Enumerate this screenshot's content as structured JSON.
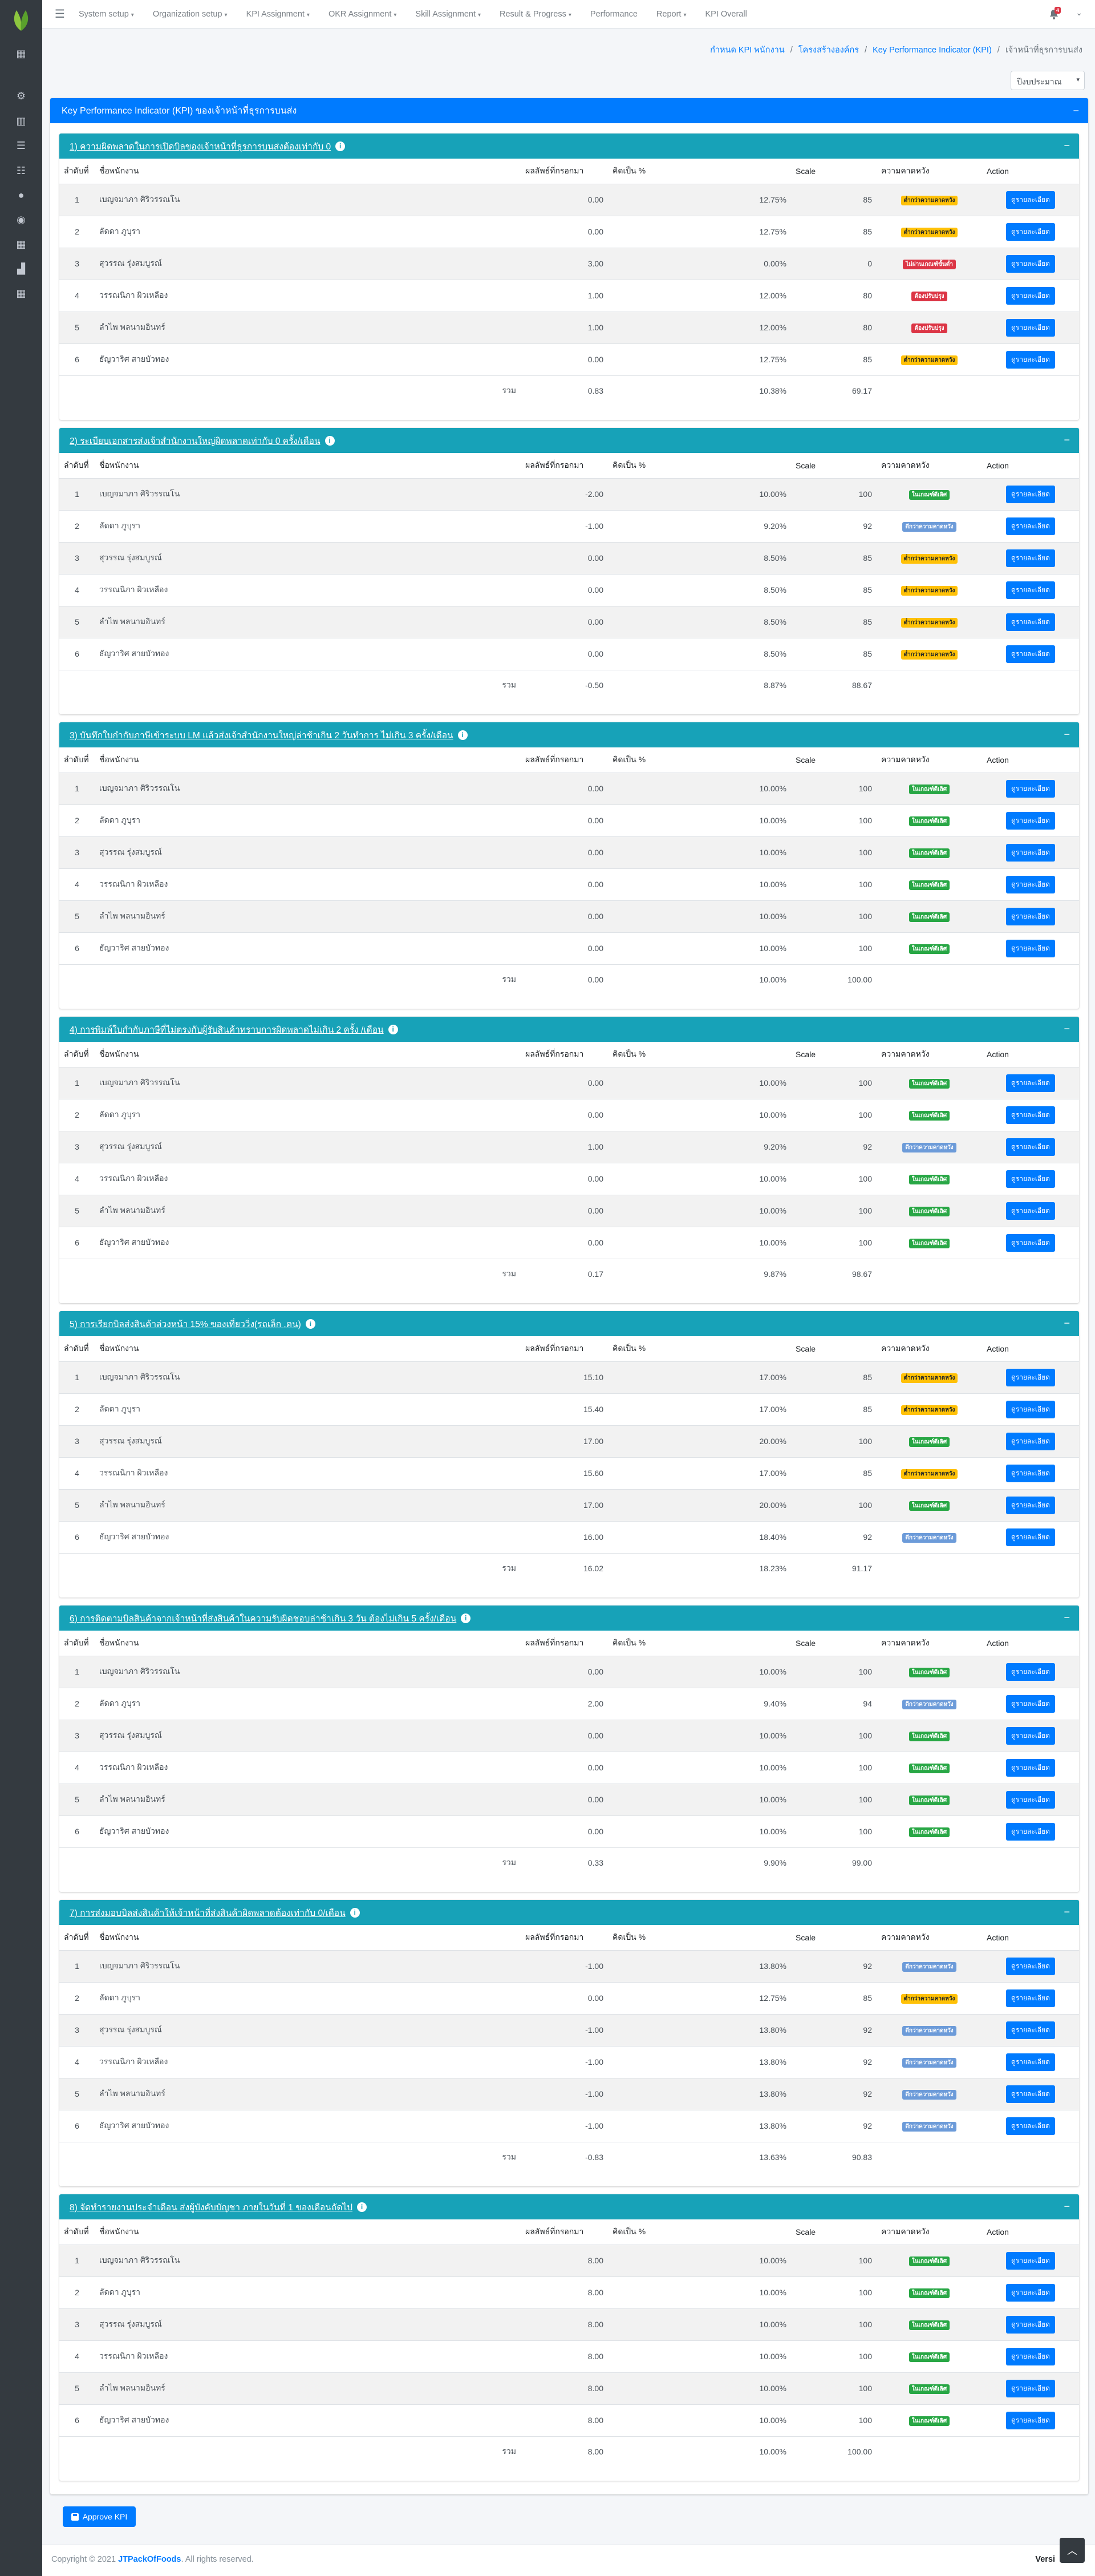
{
  "topbar": {
    "menus": [
      "System setup",
      "Organization setup",
      "KPI Assignment",
      "OKR Assignment",
      "Skill Assignment",
      "Result & Progress",
      "Performance",
      "Report",
      "KPI Overall"
    ],
    "menu_has_caret": [
      true,
      true,
      true,
      true,
      true,
      true,
      false,
      true,
      false
    ],
    "notif_count": "4"
  },
  "breadcrumb": [
    "กำหนด KPI พนักงาน",
    "โครงสร้างองค์กร",
    "Key Performance Indicator (KPI)",
    "เจ้าหน้าที่ธุรการบนส่ง"
  ],
  "year_select": "ปีงบประมาณ",
  "main_title": "Key Performance Indicator (KPI) ของเจ้าหน้าที่ธุรการบนส่ง",
  "columns": [
    "ลำดับที่",
    "ชื่อพนักงาน",
    "ผลลัพธ์ที่กรอกมา",
    "คิดเป็น %",
    "Scale",
    "ความคาดหวัง",
    "Action"
  ],
  "total_label": "รวม",
  "view_label": "ดูรายละเอียด",
  "employees": [
    "เบญจมาภา ศิริวรรณโน",
    "ลัดดา ภูบุรา",
    "สุวรรณ รุ่งสมบูรณ์",
    "วรรณนิภา ผิวเหลือง",
    "ลำไพ พลนามอินทร์",
    "ธัญวาริศ สายบัวทอง"
  ],
  "badge_labels": {
    "warn": "ต่ำกว่าความคาดหวัง",
    "succ": "ในเกณฑ์ดีเลิศ",
    "info": "ดีกว่าความคาดหวัง",
    "dang": "ไม่ผ่านเกณฑ์ขั้นต่ำ",
    "dang2": "ต้องปรับปรุง"
  },
  "sections": [
    {
      "title": "1) ความผิดพลาดในการเปิดบิลของเจ้าหน้าที่ธุรการบนส่งต้องเท่ากับ 0",
      "rows": [
        {
          "no": "1",
          "result": "0.00",
          "pct": "12.75%",
          "scale": "85",
          "badge": "warn"
        },
        {
          "no": "2",
          "result": "0.00",
          "pct": "12.75%",
          "scale": "85",
          "badge": "warn"
        },
        {
          "no": "3",
          "result": "3.00",
          "pct": "0.00%",
          "scale": "0",
          "badge": "dang"
        },
        {
          "no": "4",
          "result": "1.00",
          "pct": "12.00%",
          "scale": "80",
          "badge": "dang2"
        },
        {
          "no": "5",
          "result": "1.00",
          "pct": "12.00%",
          "scale": "80",
          "badge": "dang2"
        },
        {
          "no": "6",
          "result": "0.00",
          "pct": "12.75%",
          "scale": "85",
          "badge": "warn"
        }
      ],
      "total": {
        "result": "0.83",
        "pct": "10.38%",
        "scale": "69.17"
      }
    },
    {
      "title": "2) ระเบียบเอกสารส่งเจ้าสำนักงานใหญ่ผิดพลาดเท่ากับ 0 ครั้ง/เดือน",
      "rows": [
        {
          "no": "1",
          "result": "-2.00",
          "pct": "10.00%",
          "scale": "100",
          "badge": "succ"
        },
        {
          "no": "2",
          "result": "-1.00",
          "pct": "9.20%",
          "scale": "92",
          "badge": "info"
        },
        {
          "no": "3",
          "result": "0.00",
          "pct": "8.50%",
          "scale": "85",
          "badge": "warn"
        },
        {
          "no": "4",
          "result": "0.00",
          "pct": "8.50%",
          "scale": "85",
          "badge": "warn"
        },
        {
          "no": "5",
          "result": "0.00",
          "pct": "8.50%",
          "scale": "85",
          "badge": "warn"
        },
        {
          "no": "6",
          "result": "0.00",
          "pct": "8.50%",
          "scale": "85",
          "badge": "warn"
        }
      ],
      "total": {
        "result": "-0.50",
        "pct": "8.87%",
        "scale": "88.67"
      }
    },
    {
      "title": "3) บันทึกใบกำกับภาษีเข้าระบบ LM แล้วส่งเจ้าสำนักงานใหญ่ล่าช้าเกิน 2 วันทำการ ไม่เกิน 3 ครั้ง/เดือน",
      "rows": [
        {
          "no": "1",
          "result": "0.00",
          "pct": "10.00%",
          "scale": "100",
          "badge": "succ"
        },
        {
          "no": "2",
          "result": "0.00",
          "pct": "10.00%",
          "scale": "100",
          "badge": "succ"
        },
        {
          "no": "3",
          "result": "0.00",
          "pct": "10.00%",
          "scale": "100",
          "badge": "succ"
        },
        {
          "no": "4",
          "result": "0.00",
          "pct": "10.00%",
          "scale": "100",
          "badge": "succ"
        },
        {
          "no": "5",
          "result": "0.00",
          "pct": "10.00%",
          "scale": "100",
          "badge": "succ"
        },
        {
          "no": "6",
          "result": "0.00",
          "pct": "10.00%",
          "scale": "100",
          "badge": "succ"
        }
      ],
      "total": {
        "result": "0.00",
        "pct": "10.00%",
        "scale": "100.00"
      }
    },
    {
      "title": "4) การพิมพ์ใบกำกับภาษีที่ไม่ตรงกับผู้รับสินค้าทราบการผิดพลาดไม่เกิน 2 ครั้ง /เดือน",
      "rows": [
        {
          "no": "1",
          "result": "0.00",
          "pct": "10.00%",
          "scale": "100",
          "badge": "succ"
        },
        {
          "no": "2",
          "result": "0.00",
          "pct": "10.00%",
          "scale": "100",
          "badge": "succ"
        },
        {
          "no": "3",
          "result": "1.00",
          "pct": "9.20%",
          "scale": "92",
          "badge": "info"
        },
        {
          "no": "4",
          "result": "0.00",
          "pct": "10.00%",
          "scale": "100",
          "badge": "succ"
        },
        {
          "no": "5",
          "result": "0.00",
          "pct": "10.00%",
          "scale": "100",
          "badge": "succ"
        },
        {
          "no": "6",
          "result": "0.00",
          "pct": "10.00%",
          "scale": "100",
          "badge": "succ"
        }
      ],
      "total": {
        "result": "0.17",
        "pct": "9.87%",
        "scale": "98.67"
      }
    },
    {
      "title": "5) การเรียกบิลส่งสินค้าล่วงหน้า 15% ของเที่ยววิ่ง(รถเล็ก ,คน)",
      "rows": [
        {
          "no": "1",
          "result": "15.10",
          "pct": "17.00%",
          "scale": "85",
          "badge": "warn"
        },
        {
          "no": "2",
          "result": "15.40",
          "pct": "17.00%",
          "scale": "85",
          "badge": "warn"
        },
        {
          "no": "3",
          "result": "17.00",
          "pct": "20.00%",
          "scale": "100",
          "badge": "succ"
        },
        {
          "no": "4",
          "result": "15.60",
          "pct": "17.00%",
          "scale": "85",
          "badge": "warn"
        },
        {
          "no": "5",
          "result": "17.00",
          "pct": "20.00%",
          "scale": "100",
          "badge": "succ"
        },
        {
          "no": "6",
          "result": "16.00",
          "pct": "18.40%",
          "scale": "92",
          "badge": "info"
        }
      ],
      "total": {
        "result": "16.02",
        "pct": "18.23%",
        "scale": "91.17"
      }
    },
    {
      "title": "6) การติดตามบิลสินค้าจากเจ้าหน้าที่ส่งสินค้าในความรับผิดชอบล่าช้าเกิน 3 วัน ต้องไม่เกิน 5 ครั้ง/เดือน",
      "rows": [
        {
          "no": "1",
          "result": "0.00",
          "pct": "10.00%",
          "scale": "100",
          "badge": "succ"
        },
        {
          "no": "2",
          "result": "2.00",
          "pct": "9.40%",
          "scale": "94",
          "badge": "info"
        },
        {
          "no": "3",
          "result": "0.00",
          "pct": "10.00%",
          "scale": "100",
          "badge": "succ"
        },
        {
          "no": "4",
          "result": "0.00",
          "pct": "10.00%",
          "scale": "100",
          "badge": "succ"
        },
        {
          "no": "5",
          "result": "0.00",
          "pct": "10.00%",
          "scale": "100",
          "badge": "succ"
        },
        {
          "no": "6",
          "result": "0.00",
          "pct": "10.00%",
          "scale": "100",
          "badge": "succ"
        }
      ],
      "total": {
        "result": "0.33",
        "pct": "9.90%",
        "scale": "99.00"
      }
    },
    {
      "title": "7) การส่งมอบบิลส่งสินค้าให้เจ้าหน้าที่ส่งสินค้าผิดพลาดต้องเท่ากับ 0/เดือน",
      "rows": [
        {
          "no": "1",
          "result": "-1.00",
          "pct": "13.80%",
          "scale": "92",
          "badge": "info"
        },
        {
          "no": "2",
          "result": "0.00",
          "pct": "12.75%",
          "scale": "85",
          "badge": "warn"
        },
        {
          "no": "3",
          "result": "-1.00",
          "pct": "13.80%",
          "scale": "92",
          "badge": "info"
        },
        {
          "no": "4",
          "result": "-1.00",
          "pct": "13.80%",
          "scale": "92",
          "badge": "info"
        },
        {
          "no": "5",
          "result": "-1.00",
          "pct": "13.80%",
          "scale": "92",
          "badge": "info"
        },
        {
          "no": "6",
          "result": "-1.00",
          "pct": "13.80%",
          "scale": "92",
          "badge": "info"
        }
      ],
      "total": {
        "result": "-0.83",
        "pct": "13.63%",
        "scale": "90.83"
      }
    },
    {
      "title": "8) จัดทำรายงานประจำเดือน ส่งผู้บังคับบัญชา ภายในวันที่ 1 ของเดือนถัดไป",
      "rows": [
        {
          "no": "1",
          "result": "8.00",
          "pct": "10.00%",
          "scale": "100",
          "badge": "succ"
        },
        {
          "no": "2",
          "result": "8.00",
          "pct": "10.00%",
          "scale": "100",
          "badge": "succ"
        },
        {
          "no": "3",
          "result": "8.00",
          "pct": "10.00%",
          "scale": "100",
          "badge": "succ"
        },
        {
          "no": "4",
          "result": "8.00",
          "pct": "10.00%",
          "scale": "100",
          "badge": "succ"
        },
        {
          "no": "5",
          "result": "8.00",
          "pct": "10.00%",
          "scale": "100",
          "badge": "succ"
        },
        {
          "no": "6",
          "result": "8.00",
          "pct": "10.00%",
          "scale": "100",
          "badge": "succ"
        }
      ],
      "total": {
        "result": "8.00",
        "pct": "10.00%",
        "scale": "100.00"
      }
    }
  ],
  "approve_label": "Approve KPI",
  "footer": {
    "prefix": "Copyright © 2021 ",
    "company": "JTPackOfFoods",
    "suffix": ". All rights reserved.",
    "version": "Versi"
  },
  "colors": {
    "primary": "#007bff",
    "section_header": "#17a2b8",
    "sidebar": "#343a40",
    "warning": "#ffc107",
    "success": "#28a745",
    "danger": "#dc3545",
    "info_badge": "#6c9bd9"
  }
}
